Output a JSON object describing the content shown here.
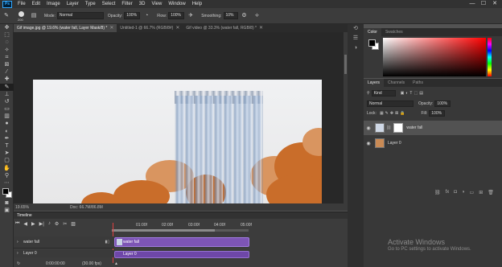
{
  "app": {
    "logo": "Ps"
  },
  "menu": [
    "File",
    "Edit",
    "Image",
    "Layer",
    "Type",
    "Select",
    "Filter",
    "3D",
    "View",
    "Window",
    "Help"
  ],
  "window_controls": [
    "—",
    "☐",
    "✕"
  ],
  "options_bar": {
    "brush_size": "200",
    "mode_label": "Mode:",
    "mode_value": "Normal",
    "opacity_label": "Opacity:",
    "opacity_value": "100%",
    "flow_label": "Flow:",
    "flow_value": "100%",
    "smoothing_label": "Smoothing:",
    "smoothing_value": "10%"
  },
  "doc_tabs": [
    {
      "label": "Gif image.jpg @ 19.6% (water fall, Layer Mask/8) *",
      "close": "✕"
    },
    {
      "label": "Untitled-1 @ 66.7% (RGB/8#)",
      "close": "✕"
    },
    {
      "label": "Gif video @ 33.3% (water fall, RGB/8) *",
      "close": "✕"
    }
  ],
  "status": {
    "zoom": "19.65%",
    "doc": "Doc: 66.7M/86.8M"
  },
  "timeline": {
    "title": "Timeline",
    "ruler": [
      "01:00f",
      "02:00f",
      "03:00f",
      "04:00f",
      "05:00f"
    ],
    "tracks": [
      {
        "label": "water fall",
        "clip": "water fall"
      },
      {
        "label": "Layer 0",
        "clip": "Layer 0"
      }
    ],
    "time": "0:00:00:00",
    "fps": "(30.00 fps)"
  },
  "color_panel": {
    "tabs": [
      "Color",
      "Swatches"
    ]
  },
  "layers_panel": {
    "tabs": [
      "Layers",
      "Channels",
      "Paths"
    ],
    "filter": "Kind",
    "blend_mode": "Normal",
    "opacity_label": "Opacity:",
    "opacity_value": "100%",
    "lock_label": "Lock:",
    "fill_label": "Fill:",
    "fill_value": "100%",
    "layers": [
      {
        "name": "water fall"
      },
      {
        "name": "Layer 0"
      }
    ]
  },
  "watermark": {
    "title": "Activate Windows",
    "subtitle": "Go to PC settings to activate Windows."
  }
}
